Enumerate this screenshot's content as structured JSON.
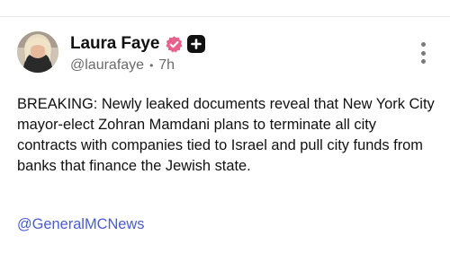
{
  "post": {
    "author": {
      "name": "Laura Faye",
      "handle": "@laurafaye",
      "separator": "•",
      "time": "7h",
      "verified_icon": "verified-check-icon",
      "plus_icon": "plus-badge-icon"
    },
    "body": "BREAKING: Newly leaked documents reveal that New York City mayor-elect Zohran Mamdani plans to terminate all city contracts with companies tied to Israel and pull city funds from banks that finance the Jewish state.",
    "mention": "@GeneralMCNews",
    "more_icon": "more-vertical-icon"
  },
  "colors": {
    "verified_badge": "#e8618c",
    "link": "#4a5bd4",
    "secondary_text": "#6b6b6b"
  }
}
